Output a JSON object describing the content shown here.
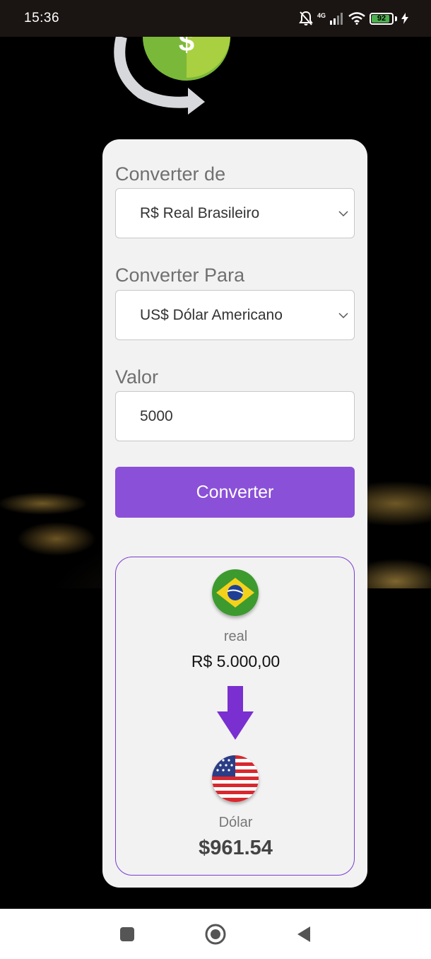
{
  "status_bar": {
    "time": "15:36",
    "network_label": "4G",
    "battery_level": "92",
    "icons": [
      "bell-off-icon",
      "signal-icon",
      "wifi-icon",
      "battery-icon",
      "charging-icon"
    ]
  },
  "form": {
    "from_label": "Converter de",
    "from_value": "R$ Real Brasileiro",
    "to_label": "Converter Para",
    "to_value": "US$ Dólar Americano",
    "amount_label": "Valor",
    "amount_value": "5000",
    "convert_button": "Converter"
  },
  "result": {
    "from_currency_name": "real",
    "from_amount": "R$ 5.000,00",
    "to_currency_name": "Dólar",
    "to_amount": "$961.54"
  },
  "colors": {
    "accent": "#8a50d8",
    "result_border": "#7a3bd0",
    "card_bg": "#f2f2f2"
  },
  "nav_bar": {
    "icons": [
      "recent-apps-icon",
      "home-icon",
      "back-icon"
    ]
  }
}
